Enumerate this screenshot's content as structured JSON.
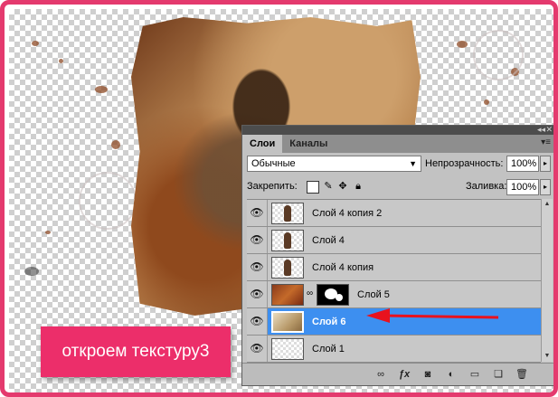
{
  "callout": {
    "text": "откроем текстуру3"
  },
  "panel": {
    "tabs": [
      "Слои",
      "Каналы"
    ],
    "blend_mode": "Обычные",
    "opacity_label": "Непрозрачность:",
    "opacity_value": "100%",
    "lock_label": "Закрепить:",
    "fill_label": "Заливка:",
    "fill_value": "100%",
    "layers": [
      {
        "name": "Слой 4 копия 2",
        "selected": false
      },
      {
        "name": "Слой 4",
        "selected": false
      },
      {
        "name": "Слой 4 копия",
        "selected": false
      },
      {
        "name": "Слой 5",
        "selected": false,
        "has_mask": true
      },
      {
        "name": "Слой 6",
        "selected": true
      },
      {
        "name": "Слой 1",
        "selected": false
      }
    ],
    "bottom_icons": [
      "link-icon",
      "fx-icon",
      "mask-icon",
      "adjustment-icon",
      "group-icon",
      "new-layer-icon",
      "trash-icon"
    ]
  },
  "colors": {
    "frame": "#e43a6e",
    "callout": "#ec2e6a",
    "selection": "#3d8ff0",
    "arrow": "#e8121e"
  }
}
